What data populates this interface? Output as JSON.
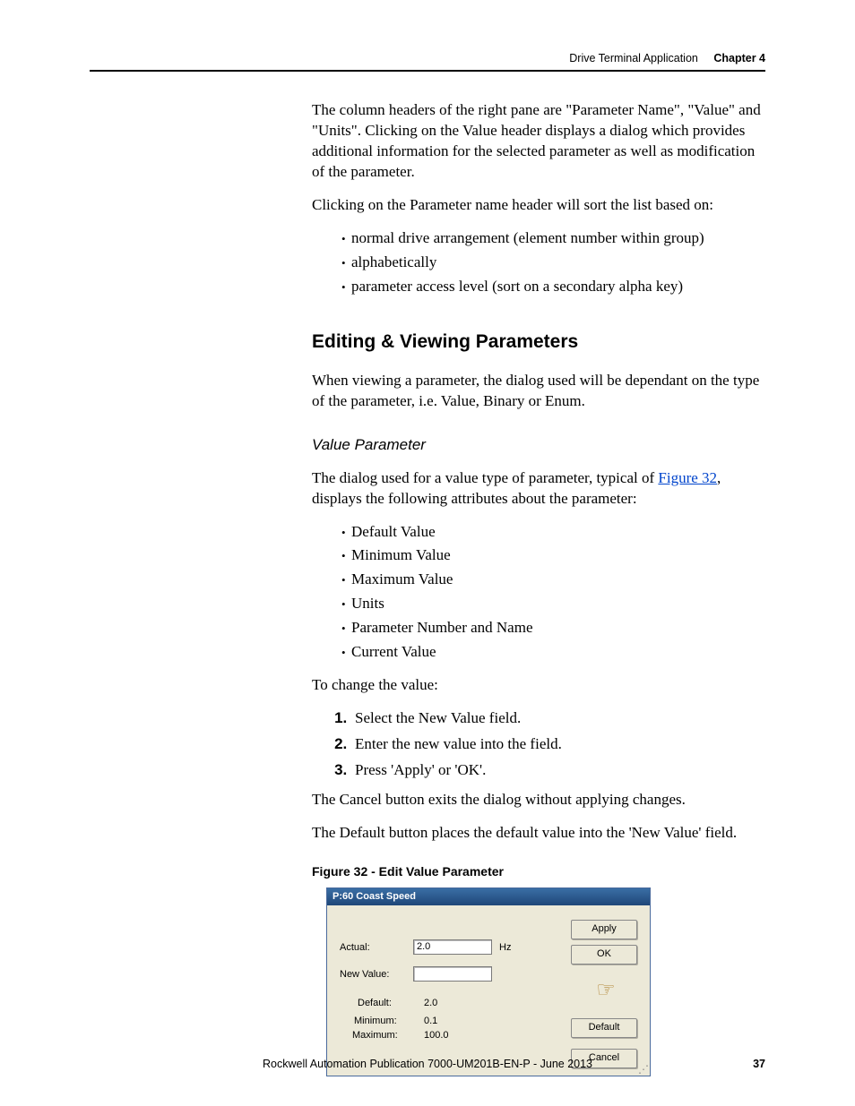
{
  "header": {
    "title_light": "Drive Terminal Application",
    "title_bold": "Chapter 4"
  },
  "body": {
    "p1": "The column headers of the right pane are \"Parameter Name\", \"Value\" and \"Units\". Clicking on the Value header displays a dialog which provides additional information for the selected parameter as well as modification of the parameter.",
    "p2": "Clicking on the Parameter name header will sort the list based on:",
    "sort_list": [
      "normal drive arrangement (element number within group)",
      "alphabetically",
      "parameter access level (sort on a secondary alpha key)"
    ],
    "h2": "Editing & Viewing Parameters",
    "p3": "When viewing a parameter, the dialog used will be dependant on the type of the parameter, i.e. Value, Binary or Enum.",
    "sub1": "Value Parameter",
    "p4a": "The dialog used for a value type of parameter, typical of ",
    "p4_link": "Figure 32",
    "p4b": ", displays the following attributes about the parameter:",
    "attr_list": [
      "Default Value",
      "Minimum Value",
      "Maximum Value",
      "Units",
      "Parameter Number and Name",
      "Current Value"
    ],
    "p5": "To change the value:",
    "steps": [
      "Select the New Value field.",
      "Enter the new value into the field.",
      "Press 'Apply' or 'OK'."
    ],
    "after1": "The Cancel button exits the dialog without applying changes.",
    "after2": "The Default button places the default value into the 'New Value' field.",
    "fig_caption": "Figure 32 - Edit Value Parameter"
  },
  "dialog": {
    "title": "P:60 Coast Speed",
    "actual_label": "Actual:",
    "actual_value": "2.0",
    "units": "Hz",
    "newvalue_label": "New Value:",
    "newvalue_value": "",
    "default_label": "Default:",
    "default_value": "2.0",
    "min_label": "Minimum:",
    "min_value": "0.1",
    "max_label": "Maximum:",
    "max_value": "100.0",
    "btn_apply": "Apply",
    "btn_ok": "OK",
    "btn_default": "Default",
    "btn_cancel": "Cancel"
  },
  "footer": {
    "text": "Rockwell Automation Publication 7000-UM201B-EN-P - June 2013",
    "page": "37"
  }
}
